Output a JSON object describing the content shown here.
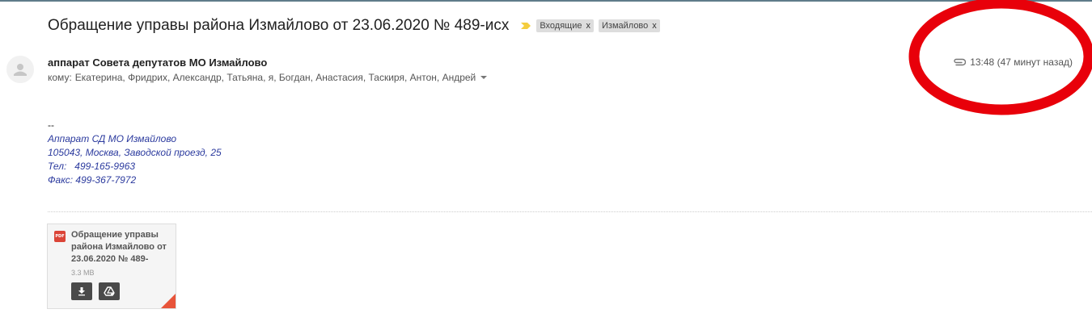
{
  "email": {
    "subject": "Обращение управы района Измайлово от 23.06.2020 № 489-исх",
    "labels": [
      {
        "name": "Входящие",
        "close": "x"
      },
      {
        "name": "Измайлово",
        "close": "x"
      }
    ],
    "sender": "аппарат Совета депутатов МО Измайлово",
    "to_label": "кому:",
    "recipients": "Екатерина, Фридрих, Александр, Татьяна, я, Богдан, Анастасия, Таскиря, Антон, Андрей",
    "time": "13:48 (47 минут назад)"
  },
  "signature": {
    "dash": "--",
    "lines": [
      "Аппарат СД МО Измайлово",
      "105043, Москва, Заводской проезд, 25",
      "Тел:   499-165-9963",
      "Факс: 499-367-7972"
    ]
  },
  "attachment": {
    "icon_text": "PDF",
    "name": "Обращение управы района Измайлово от 23.06.2020 № 489-",
    "size": "3.3 MB"
  },
  "colors": {
    "signature": "#2b3a9e",
    "pdf": "#db4437",
    "annotation": "#e8000a",
    "importance": "#f4cd3e"
  },
  "icons": {
    "importance": "importance-marker-icon",
    "attachment": "paperclip-icon",
    "download": "download-icon",
    "drive": "drive-icon"
  }
}
